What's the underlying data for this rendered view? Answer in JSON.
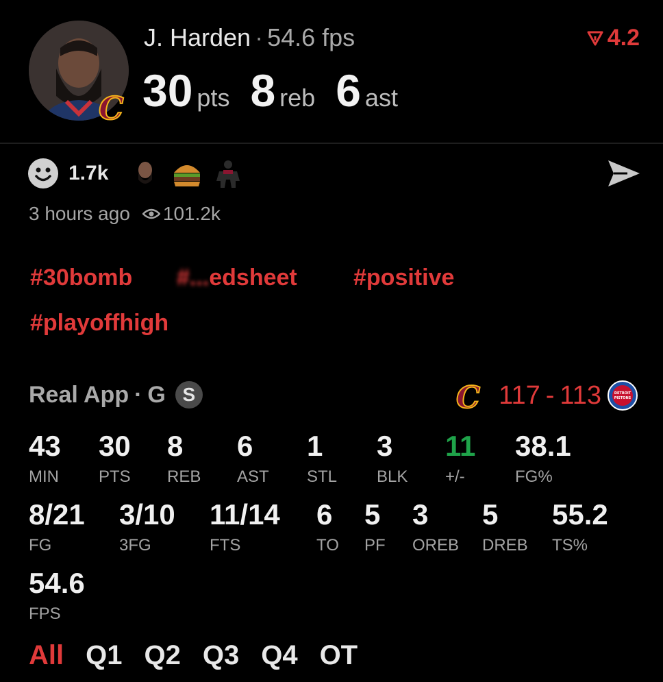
{
  "player": {
    "name": "J. Harden",
    "separator": "·",
    "fps": "54.6 fps"
  },
  "statline": [
    {
      "num": "30",
      "unit": "pts"
    },
    {
      "num": "8",
      "unit": "reb"
    },
    {
      "num": "6",
      "unit": "ast"
    }
  ],
  "rating": {
    "value": "4.2",
    "color": "#e03a3a"
  },
  "reactions": {
    "count": "1.7k",
    "icons": [
      "smiley-icon",
      "player-emoji-icon",
      "burger-emoji-icon",
      "player-silhouette-icon"
    ]
  },
  "meta": {
    "time": "3 hours ago",
    "views": "101.2k"
  },
  "tags": [
    "#30bomb",
    "#...edsheet",
    "#positive",
    "#playoffhigh"
  ],
  "game": {
    "source": "Real App",
    "sep": "·",
    "position": "G",
    "badge": "S",
    "team_score": "117",
    "dash": "-",
    "opp_score": "113",
    "opp_logo_text": "DETROIT PISTONS"
  },
  "stats_row1": [
    {
      "v": "43",
      "l": "MIN"
    },
    {
      "v": "30",
      "l": "PTS"
    },
    {
      "v": "8",
      "l": "REB"
    },
    {
      "v": "6",
      "l": "AST"
    },
    {
      "v": "1",
      "l": "STL"
    },
    {
      "v": "3",
      "l": "BLK"
    },
    {
      "v": "11",
      "l": "+/-"
    },
    {
      "v": "38.1",
      "l": "FG%"
    }
  ],
  "stats_row2": [
    {
      "v": "8/21",
      "l": "FG"
    },
    {
      "v": "3/10",
      "l": "3FG"
    },
    {
      "v": "11/14",
      "l": "FTS"
    },
    {
      "v": "6",
      "l": "TO"
    },
    {
      "v": "5",
      "l": "PF"
    },
    {
      "v": "3",
      "l": "OREB"
    },
    {
      "v": "5",
      "l": "DREB"
    },
    {
      "v": "55.2",
      "l": "TS%"
    }
  ],
  "stats_row3": [
    {
      "v": "54.6",
      "l": "FPS"
    }
  ],
  "periods": [
    "All",
    "Q1",
    "Q2",
    "Q3",
    "Q4",
    "OT"
  ],
  "colors": {
    "accent": "#e03a3a",
    "positive": "#1fa34a",
    "background": "#000000"
  }
}
